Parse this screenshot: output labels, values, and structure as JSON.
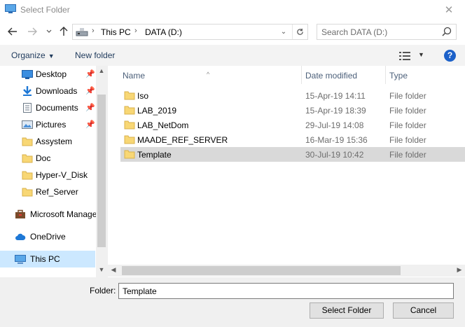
{
  "window": {
    "title": "Select Folder",
    "close_glyph": "✕"
  },
  "address": {
    "crumbs": [
      "This PC",
      "DATA (D:)"
    ],
    "search_placeholder": "Search DATA (D:)"
  },
  "commands": {
    "organize": "Organize",
    "new_folder": "New folder",
    "help": "?"
  },
  "nav": {
    "items": [
      {
        "label": "Desktop",
        "icon": "desktop-icon",
        "pinned": true
      },
      {
        "label": "Downloads",
        "icon": "download-icon",
        "pinned": true
      },
      {
        "label": "Documents",
        "icon": "documents-icon",
        "pinned": true
      },
      {
        "label": "Pictures",
        "icon": "pictures-icon",
        "pinned": true
      },
      {
        "label": "Assystem",
        "icon": "folder-icon",
        "pinned": false
      },
      {
        "label": "Doc",
        "icon": "folder-icon",
        "pinned": false
      },
      {
        "label": "Hyper-V_Disk",
        "icon": "folder-icon",
        "pinned": false
      },
      {
        "label": "Ref_Server",
        "icon": "folder-icon",
        "pinned": false
      },
      {
        "label": "Microsoft Manage",
        "icon": "briefcase-icon",
        "pinned": false
      },
      {
        "label": "OneDrive",
        "icon": "cloud-icon",
        "pinned": false
      },
      {
        "label": "This PC",
        "icon": "computer-icon",
        "pinned": false,
        "selected": true
      }
    ]
  },
  "columns": {
    "name": "Name",
    "date": "Date modified",
    "type": "Type"
  },
  "files": [
    {
      "name": "Iso",
      "date": "15-Apr-19 14:11",
      "type": "File folder"
    },
    {
      "name": "LAB_2019",
      "date": "15-Apr-19 18:39",
      "type": "File folder"
    },
    {
      "name": "LAB_NetDom",
      "date": "29-Jul-19 14:08",
      "type": "File folder"
    },
    {
      "name": "MAADE_REF_SERVER",
      "date": "16-Mar-19 15:36",
      "type": "File folder"
    },
    {
      "name": "Template",
      "date": "30-Jul-19 10:42",
      "type": "File folder",
      "selected": true
    }
  ],
  "footer": {
    "folder_label": "Folder:",
    "folder_value": "Template",
    "select_button": "Select Folder",
    "cancel_button": "Cancel"
  },
  "colors": {
    "selection_nav": "#cce8ff",
    "selection_list": "#d9d9d9",
    "folder_yellow": "#f8d775",
    "help_blue": "#1c61c9"
  }
}
